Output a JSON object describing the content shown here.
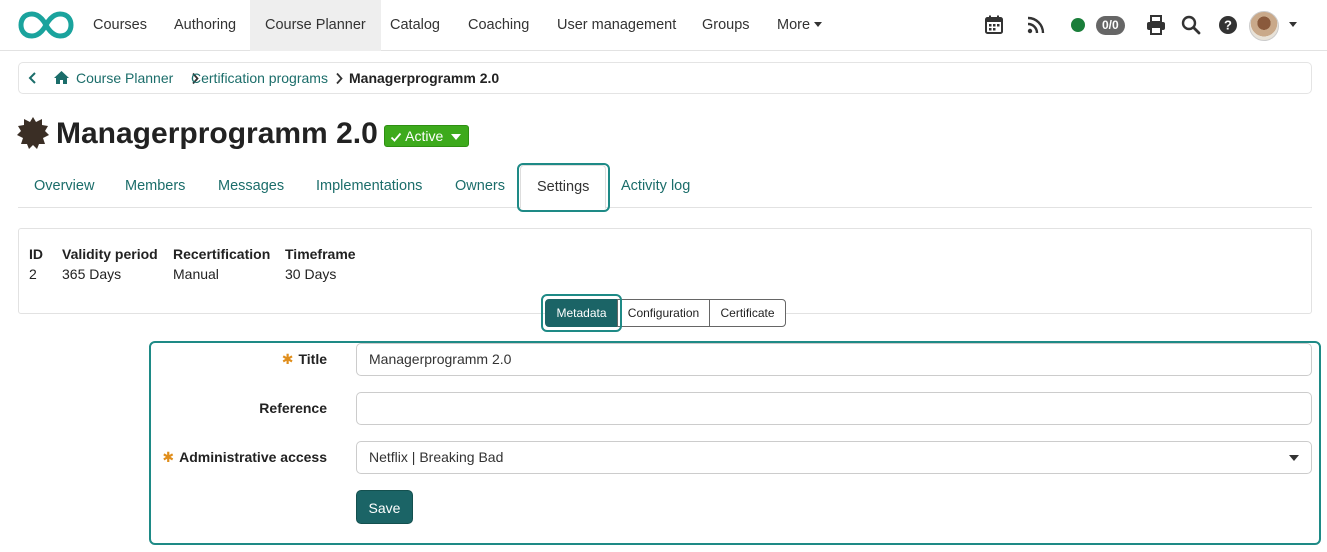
{
  "nav": {
    "items": [
      {
        "label": "Courses"
      },
      {
        "label": "Authoring"
      },
      {
        "label": "Course Planner"
      },
      {
        "label": "Catalog"
      },
      {
        "label": "Coaching"
      },
      {
        "label": "User management"
      },
      {
        "label": "Groups"
      },
      {
        "label": "More"
      }
    ],
    "active_item": "Course Planner",
    "counter": "0/0",
    "icons": [
      "calendar-icon",
      "rss-icon",
      "status-dot",
      "print-icon",
      "search-icon",
      "help-icon",
      "avatar"
    ]
  },
  "breadcrumb": {
    "items": [
      "Course Planner",
      "Certification programs"
    ],
    "current": "Managerprogramm 2.0"
  },
  "page": {
    "title": "Managerprogramm 2.0",
    "status": "Active"
  },
  "tabs": {
    "items": [
      "Overview",
      "Members",
      "Messages",
      "Implementations",
      "Owners",
      "Settings",
      "Activity log"
    ],
    "active": "Settings"
  },
  "info": {
    "columns": [
      {
        "label": "ID",
        "value": "2"
      },
      {
        "label": "Validity period",
        "value": "365 Days"
      },
      {
        "label": "Recertification",
        "value": "Manual"
      },
      {
        "label": "Timeframe",
        "value": "30 Days"
      }
    ]
  },
  "subtabs": {
    "items": [
      "Metadata",
      "Configuration",
      "Certificate"
    ],
    "active": "Metadata"
  },
  "form": {
    "title_label": "Title",
    "title_value": "Managerprogramm 2.0",
    "reference_label": "Reference",
    "reference_value": "",
    "access_label": "Administrative access",
    "access_value": "Netflix | Breaking Bad",
    "save_label": "Save",
    "required_marker": "✱"
  },
  "colors": {
    "brand": "#1b6466",
    "link": "#1b6d6a",
    "active_badge": "#3daa1c",
    "required": "#e08e1c",
    "highlight": "#1e8a86"
  }
}
